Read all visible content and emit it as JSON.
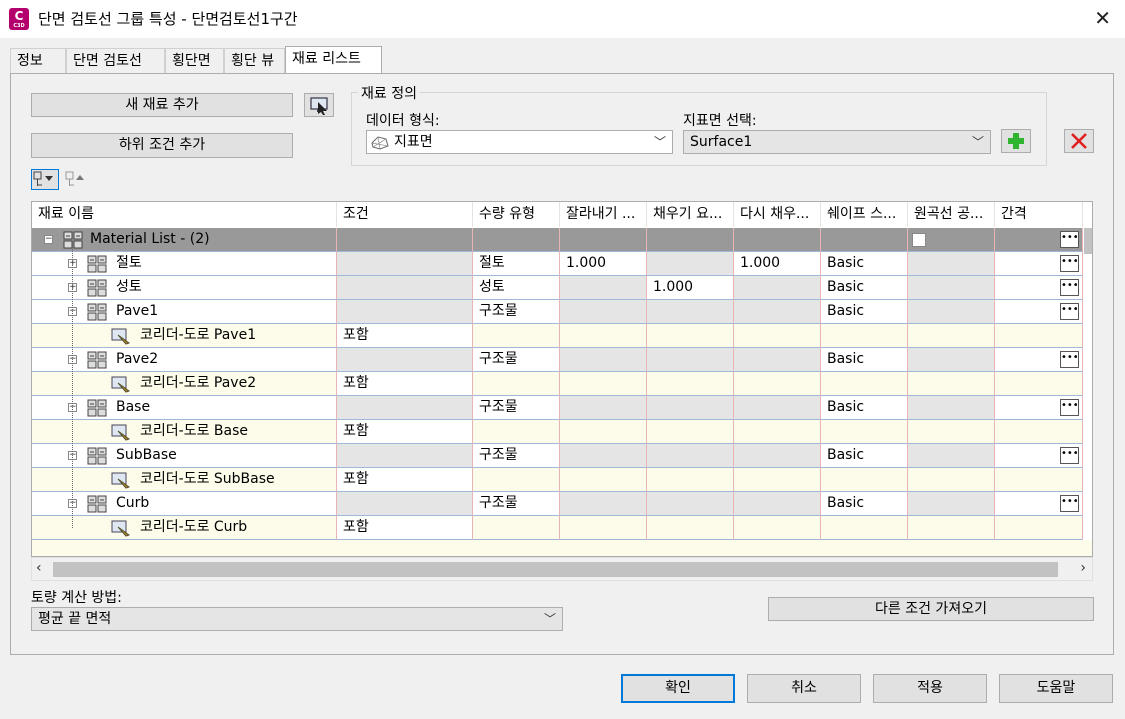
{
  "window": {
    "title": "단면 검토선 그룹 특성 - 단면검토선1구간",
    "app_icon_letter": "C",
    "app_icon_caption": "C3D"
  },
  "tabs": [
    "정보",
    "단면 검토선",
    "횡단면",
    "횡단 뷰",
    "재료 리스트"
  ],
  "left_buttons": {
    "add_material": "새 재료 추가",
    "add_subcondition": "하위 조건 추가"
  },
  "material_definition": {
    "legend": "재료 정의",
    "data_type_label": "데이터 형식:",
    "data_type_value": "지표면",
    "surface_label": "지표면 선택:",
    "surface_value": "Surface1"
  },
  "grid": {
    "columns": [
      "재료 이름",
      "조건",
      "수량 유형",
      "잘라내기 ...",
      "채우기 요...",
      "다시 채우...",
      "쉐이프 스...",
      "원곡선 공...",
      "간격"
    ],
    "root": {
      "name": "Material List - (2)"
    },
    "rows": [
      {
        "name": "절토",
        "condition": "",
        "qty_type": "절토",
        "cut": "1.000",
        "fill": "",
        "refill": "1.000",
        "shape": "Basic",
        "child": null
      },
      {
        "name": "성토",
        "condition": "",
        "qty_type": "성토",
        "cut": "",
        "fill": "1.000",
        "refill": "",
        "shape": "Basic",
        "child": null
      },
      {
        "name": "Pave1",
        "condition": "",
        "qty_type": "구조물",
        "cut": "",
        "fill": "",
        "refill": "",
        "shape": "Basic",
        "child": {
          "name": "코리더-도로 Pave1",
          "condition": "포함"
        }
      },
      {
        "name": "Pave2",
        "condition": "",
        "qty_type": "구조물",
        "cut": "",
        "fill": "",
        "refill": "",
        "shape": "Basic",
        "child": {
          "name": "코리더-도로 Pave2",
          "condition": "포함"
        }
      },
      {
        "name": "Base",
        "condition": "",
        "qty_type": "구조물",
        "cut": "",
        "fill": "",
        "refill": "",
        "shape": "Basic",
        "child": {
          "name": "코리더-도로 Base",
          "condition": "포함"
        }
      },
      {
        "name": "SubBase",
        "condition": "",
        "qty_type": "구조물",
        "cut": "",
        "fill": "",
        "refill": "",
        "shape": "Basic",
        "child": {
          "name": "코리더-도로 SubBase",
          "condition": "포함"
        }
      },
      {
        "name": "Curb",
        "condition": "",
        "qty_type": "구조물",
        "cut": "",
        "fill": "",
        "refill": "",
        "shape": "Basic",
        "child": {
          "name": "코리더-도로 Curb",
          "condition": "포함"
        }
      }
    ]
  },
  "earthwork": {
    "label": "토량 계산 방법:",
    "value": "평균 끝 면적"
  },
  "import_button": "다른 조건 가져오기",
  "footer": {
    "ok": "확인",
    "cancel": "취소",
    "apply": "적용",
    "help": "도움말"
  },
  "colors": {
    "material_row_gray": "#e5e5e5",
    "subcondition_row_cream": "#fdfcea",
    "root_row_dark": "#999999",
    "add_icon_green": "#2fb52f",
    "delete_icon_red": "#e02020",
    "primary_border": "#0078d7"
  }
}
